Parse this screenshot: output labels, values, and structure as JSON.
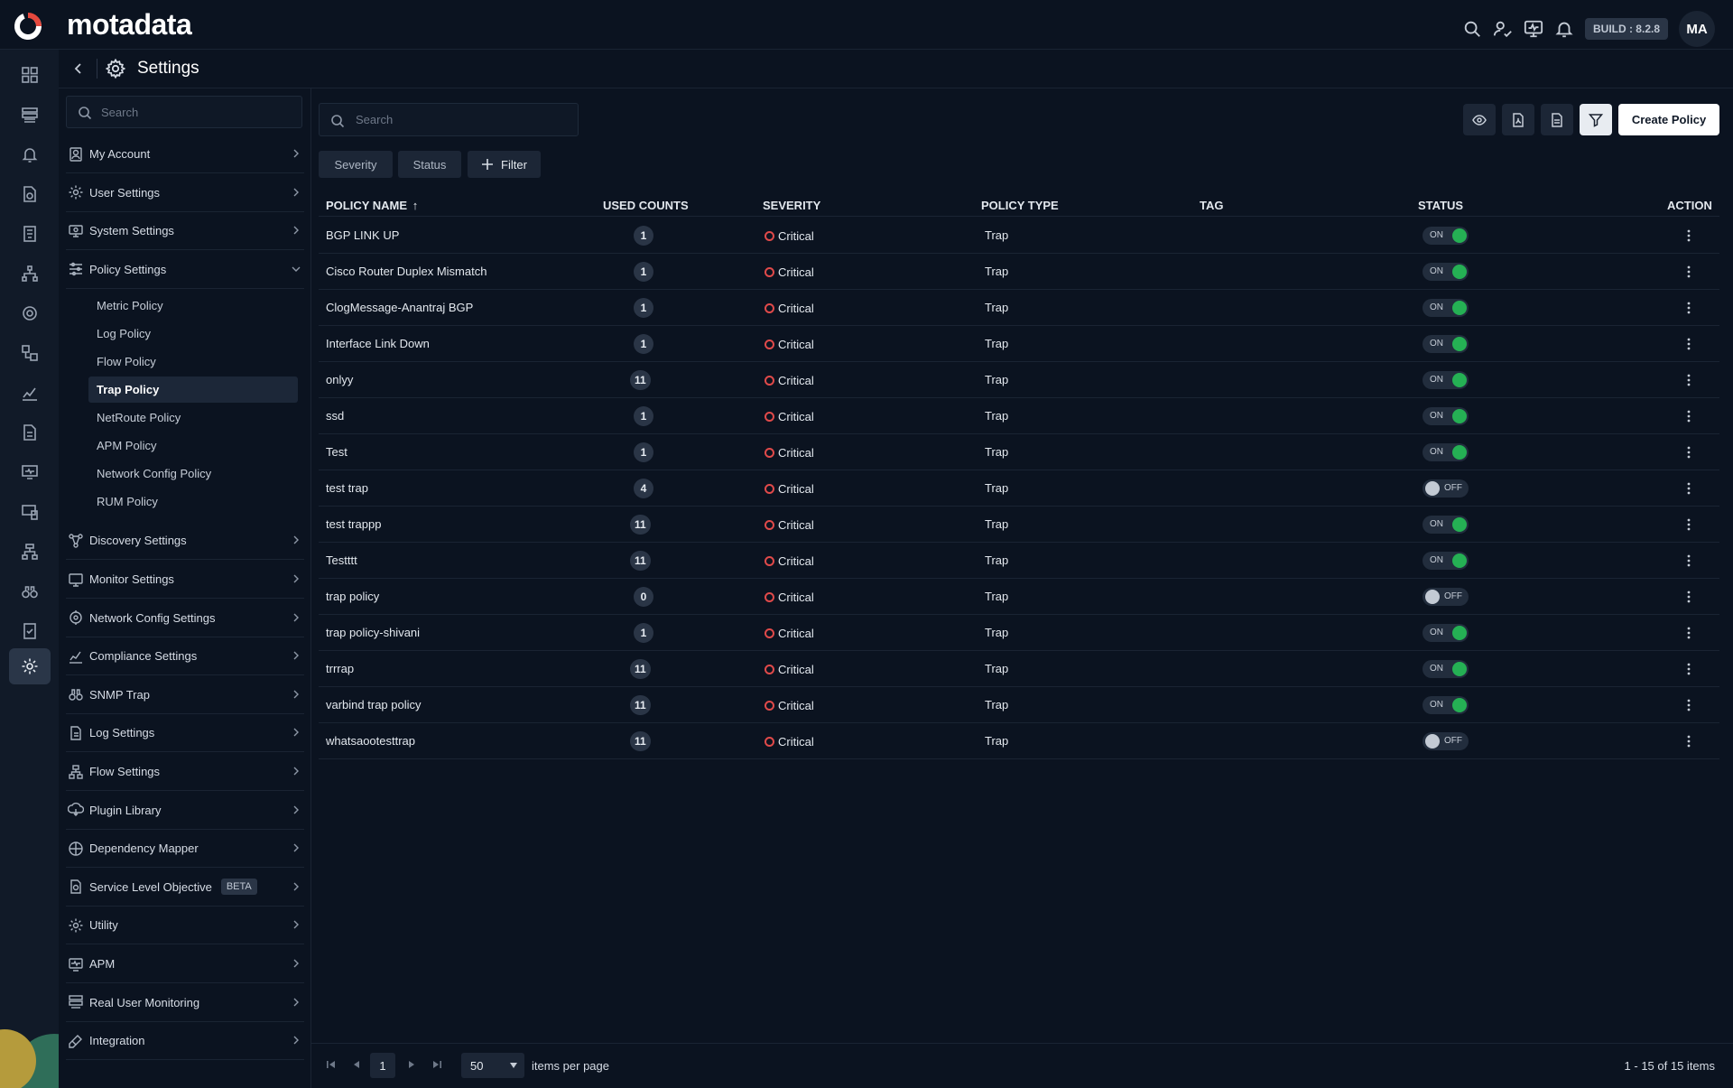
{
  "brand": {
    "name": "motadata"
  },
  "topbar": {
    "build": "BUILD : 8.2.8",
    "avatar": "MA"
  },
  "header": {
    "title": "Settings"
  },
  "nav": {
    "search_placeholder": "Search",
    "items": [
      {
        "label": "My Account",
        "icon": "account-icon"
      },
      {
        "label": "User Settings",
        "icon": "users-gear-icon"
      },
      {
        "label": "System Settings",
        "icon": "system-icon"
      },
      {
        "label": "Policy Settings",
        "icon": "policy-sliders-icon",
        "expanded": true
      },
      {
        "label": "Discovery Settings",
        "icon": "discovery-icon"
      },
      {
        "label": "Monitor Settings",
        "icon": "monitor-icon"
      },
      {
        "label": "Network Config Settings",
        "icon": "network-config-icon"
      },
      {
        "label": "Compliance Settings",
        "icon": "compliance-icon"
      },
      {
        "label": "SNMP Trap",
        "icon": "binoculars-icon"
      },
      {
        "label": "Log Settings",
        "icon": "log-icon"
      },
      {
        "label": "Flow Settings",
        "icon": "flow-icon"
      },
      {
        "label": "Plugin Library",
        "icon": "plugin-icon"
      },
      {
        "label": "Dependency Mapper",
        "icon": "dependency-icon"
      },
      {
        "label": "Service Level Objective",
        "icon": "slo-icon",
        "badge": "BETA"
      },
      {
        "label": "Utility",
        "icon": "utility-icon"
      },
      {
        "label": "APM",
        "icon": "apm-icon"
      },
      {
        "label": "Real User Monitoring",
        "icon": "rum-icon"
      },
      {
        "label": "Integration",
        "icon": "integration-icon"
      }
    ],
    "policy_sub_items": [
      {
        "label": "Metric Policy"
      },
      {
        "label": "Log Policy"
      },
      {
        "label": "Flow Policy"
      },
      {
        "label": "Trap Policy",
        "active": true
      },
      {
        "label": "NetRoute Policy"
      },
      {
        "label": "APM Policy"
      },
      {
        "label": "Network Config Policy"
      },
      {
        "label": "RUM Policy"
      }
    ]
  },
  "toolbar": {
    "search_placeholder": "Search",
    "create_label": "Create Policy",
    "chips": {
      "severity": "Severity",
      "status": "Status",
      "filter": "Filter"
    }
  },
  "table": {
    "columns": {
      "name": "POLICY NAME",
      "sort_indicator": "↑",
      "used": "USED COUNTS",
      "severity": "SEVERITY",
      "type": "POLICY TYPE",
      "tag": "TAG",
      "status": "STATUS",
      "action": "ACTION"
    },
    "rows": [
      {
        "name": "BGP LINK UP",
        "used": "1",
        "severity": "Critical",
        "type": "Trap",
        "tag": "",
        "status": "ON"
      },
      {
        "name": "Cisco Router Duplex Mismatch",
        "used": "1",
        "severity": "Critical",
        "type": "Trap",
        "tag": "",
        "status": "ON"
      },
      {
        "name": "ClogMessage-Anantraj BGP",
        "used": "1",
        "severity": "Critical",
        "type": "Trap",
        "tag": "",
        "status": "ON"
      },
      {
        "name": "Interface Link Down",
        "used": "1",
        "severity": "Critical",
        "type": "Trap",
        "tag": "",
        "status": "ON"
      },
      {
        "name": "onlyy",
        "used": "11",
        "severity": "Critical",
        "type": "Trap",
        "tag": "",
        "status": "ON"
      },
      {
        "name": "ssd",
        "used": "1",
        "severity": "Critical",
        "type": "Trap",
        "tag": "",
        "status": "ON"
      },
      {
        "name": "Test",
        "used": "1",
        "severity": "Critical",
        "type": "Trap",
        "tag": "",
        "status": "ON"
      },
      {
        "name": "test trap",
        "used": "4",
        "severity": "Critical",
        "type": "Trap",
        "tag": "",
        "status": "OFF"
      },
      {
        "name": "test trappp",
        "used": "11",
        "severity": "Critical",
        "type": "Trap",
        "tag": "",
        "status": "ON"
      },
      {
        "name": "Testttt",
        "used": "11",
        "severity": "Critical",
        "type": "Trap",
        "tag": "",
        "status": "ON"
      },
      {
        "name": "trap policy",
        "used": "0",
        "severity": "Critical",
        "type": "Trap",
        "tag": "",
        "status": "OFF"
      },
      {
        "name": "trap policy-shivani",
        "used": "1",
        "severity": "Critical",
        "type": "Trap",
        "tag": "",
        "status": "ON"
      },
      {
        "name": "trrrap",
        "used": "11",
        "severity": "Critical",
        "type": "Trap",
        "tag": "",
        "status": "ON"
      },
      {
        "name": "varbind trap policy",
        "used": "11",
        "severity": "Critical",
        "type": "Trap",
        "tag": "",
        "status": "ON"
      },
      {
        "name": "whatsaootesttrap",
        "used": "11",
        "severity": "Critical",
        "type": "Trap",
        "tag": "",
        "status": "OFF"
      }
    ]
  },
  "pagination": {
    "page": "1",
    "per_page": "50",
    "per_page_label": "items per page",
    "total": "1 - 15 of 15 items"
  },
  "colors": {
    "background": "#0b1320",
    "critical": "#e04a4a",
    "toggle_on": "#25b054",
    "toggle_off": "#c3cad4"
  }
}
